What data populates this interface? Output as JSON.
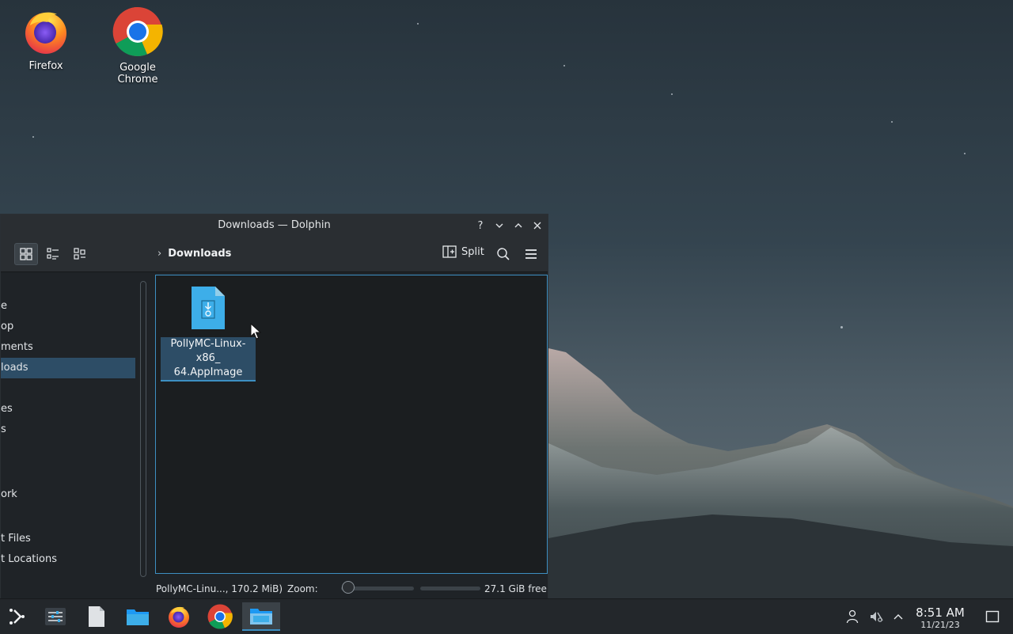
{
  "desktop": {
    "icons": [
      {
        "label": "Firefox",
        "icon": "firefox-icon"
      },
      {
        "label": "Google Chrome",
        "icon": "chrome-icon"
      }
    ]
  },
  "window": {
    "title": "Downloads — Dolphin",
    "controls": [
      "help-icon",
      "minimize-icon",
      "maximize-icon",
      "close-icon"
    ],
    "toolbar": {
      "view_modes": [
        "icons-view-icon",
        "details-view-icon",
        "compact-view-icon"
      ],
      "breadcrumb": "Downloads",
      "split_label": "Split",
      "search_icon": "search-icon",
      "menu_icon": "hamburger-menu-icon"
    },
    "sidebar": {
      "items": [
        {
          "label": "e",
          "selected": false
        },
        {
          "label": "op",
          "selected": false
        },
        {
          "label": "ments",
          "selected": false
        },
        {
          "label": "loads",
          "selected": true
        },
        {
          "label": "es",
          "selected": false
        },
        {
          "label": "s",
          "selected": false
        },
        {
          "label": "ork",
          "selected": false
        },
        {
          "label": "t Files",
          "selected": false
        },
        {
          "label": "t Locations",
          "selected": false
        }
      ]
    },
    "files": [
      {
        "name_line1": "PollyMC-Linux-x86_",
        "name_line2": "64.AppImage",
        "icon": "appimage-file-icon",
        "selected": true
      }
    ],
    "status": {
      "selection": "PollyMC-Linu..., 170.2 MiB)",
      "zoom_label": "Zoom:",
      "free_space": "27.1 GiB free"
    }
  },
  "taskbar": {
    "items": [
      {
        "icon": "app-launcher-icon"
      },
      {
        "icon": "system-settings-icon"
      },
      {
        "icon": "text-file-icon"
      },
      {
        "icon": "folder-icon"
      },
      {
        "icon": "firefox-icon"
      },
      {
        "icon": "chrome-icon"
      },
      {
        "icon": "dolphin-file-manager-icon",
        "active": true
      }
    ],
    "tray": [
      "user-icon",
      "volume-muted-icon",
      "chevron-up-icon"
    ],
    "clock": {
      "time": "8:51 AM",
      "date": "11/21/23"
    },
    "show_desktop_icon": "show-desktop-icon"
  },
  "colors": {
    "accent": "#3d8fc2",
    "selection": "#2d4d66",
    "window_bg": "#1f2327",
    "titlebar_bg": "#2a2e32"
  }
}
